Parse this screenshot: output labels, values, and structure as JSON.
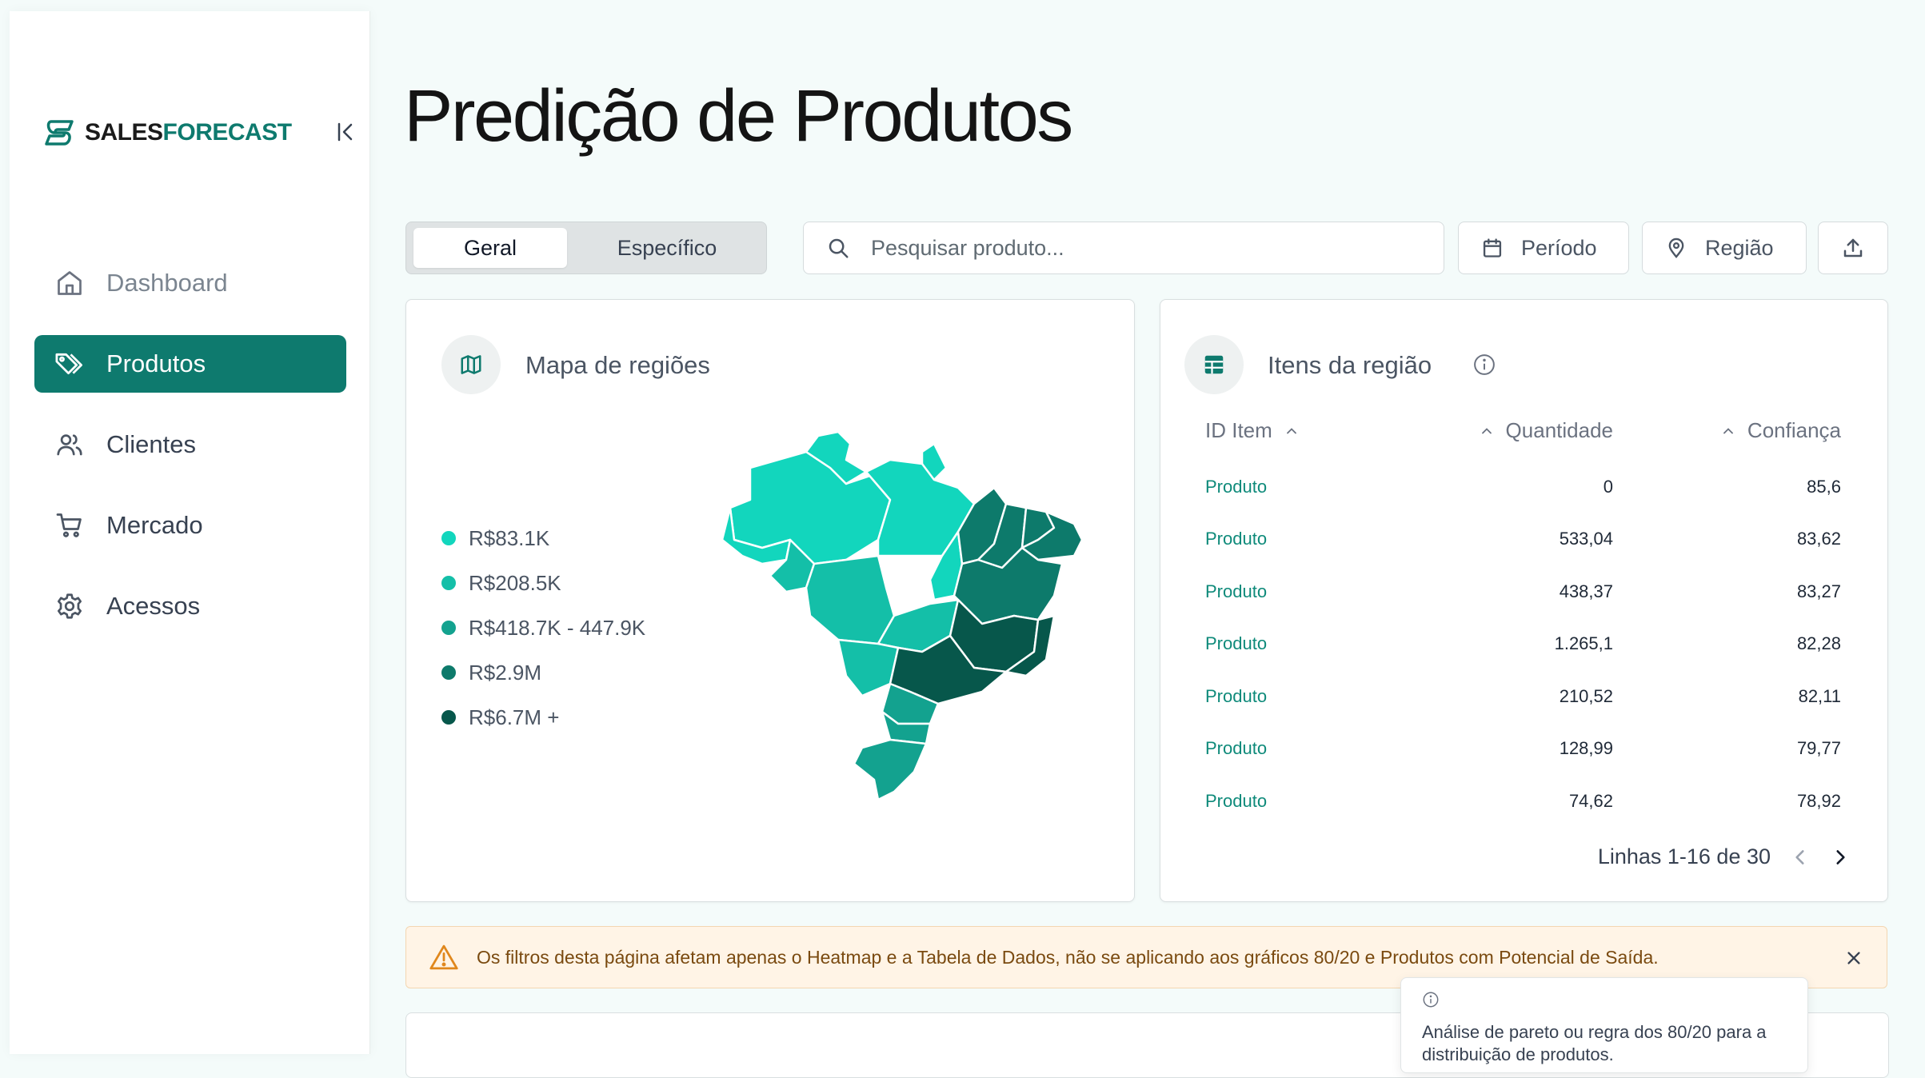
{
  "brand": {
    "name_part1": "SALES",
    "name_part2": "FORECAST",
    "color": "#0e7a6e"
  },
  "sidebar": {
    "items": [
      {
        "label": "Dashboard",
        "icon": "home-icon",
        "active": false
      },
      {
        "label": "Produtos",
        "icon": "tag-icon",
        "active": true
      },
      {
        "label": "Clientes",
        "icon": "users-icon",
        "active": false
      },
      {
        "label": "Mercado",
        "icon": "cart-icon",
        "active": false
      },
      {
        "label": "Acessos",
        "icon": "gear-icon",
        "active": false
      }
    ]
  },
  "header": {
    "title": "Predição de Produtos"
  },
  "toolbar": {
    "tabs": [
      "Geral",
      "Específico"
    ],
    "active_tab": "Geral",
    "search_placeholder": "Pesquisar produto...",
    "period_label": "Período",
    "region_label": "Região"
  },
  "map_card": {
    "title": "Mapa de regiões",
    "legend": [
      {
        "label": "R$83.1K",
        "color": "#12d6bd"
      },
      {
        "label": "R$208.5K",
        "color": "#14bfa8"
      },
      {
        "label": "R$418.7K - 447.9K",
        "color": "#13a28f"
      },
      {
        "label": "R$2.9M",
        "color": "#0d7a6b"
      },
      {
        "label": "R$6.7M +",
        "color": "#07574b"
      }
    ]
  },
  "items_card": {
    "title": "Itens da região",
    "columns": [
      "ID Item",
      "Quantidade",
      "Confiança"
    ],
    "rows": [
      {
        "id": "Produto",
        "quantidade": "0",
        "confianca": "85,6"
      },
      {
        "id": "Produto",
        "quantidade": "533,04",
        "confianca": "83,62"
      },
      {
        "id": "Produto",
        "quantidade": "438,37",
        "confianca": "83,27"
      },
      {
        "id": "Produto",
        "quantidade": "1.265,1",
        "confianca": "82,28"
      },
      {
        "id": "Produto",
        "quantidade": "210,52",
        "confianca": "82,11"
      },
      {
        "id": "Produto",
        "quantidade": "128,99",
        "confianca": "79,77"
      },
      {
        "id": "Produto",
        "quantidade": "74,62",
        "confianca": "78,92"
      }
    ],
    "pagination": "Linhas 1-16 de 30"
  },
  "alert": {
    "text": "Os filtros desta página afetam apenas o Heatmap e a Tabela de Dados, não se aplicando aos gráficos 80/20 e Produtos com Potencial de Saída."
  },
  "tooltip": {
    "text": "Análise de pareto ou regra dos 80/20 para a distribuição de produtos."
  }
}
